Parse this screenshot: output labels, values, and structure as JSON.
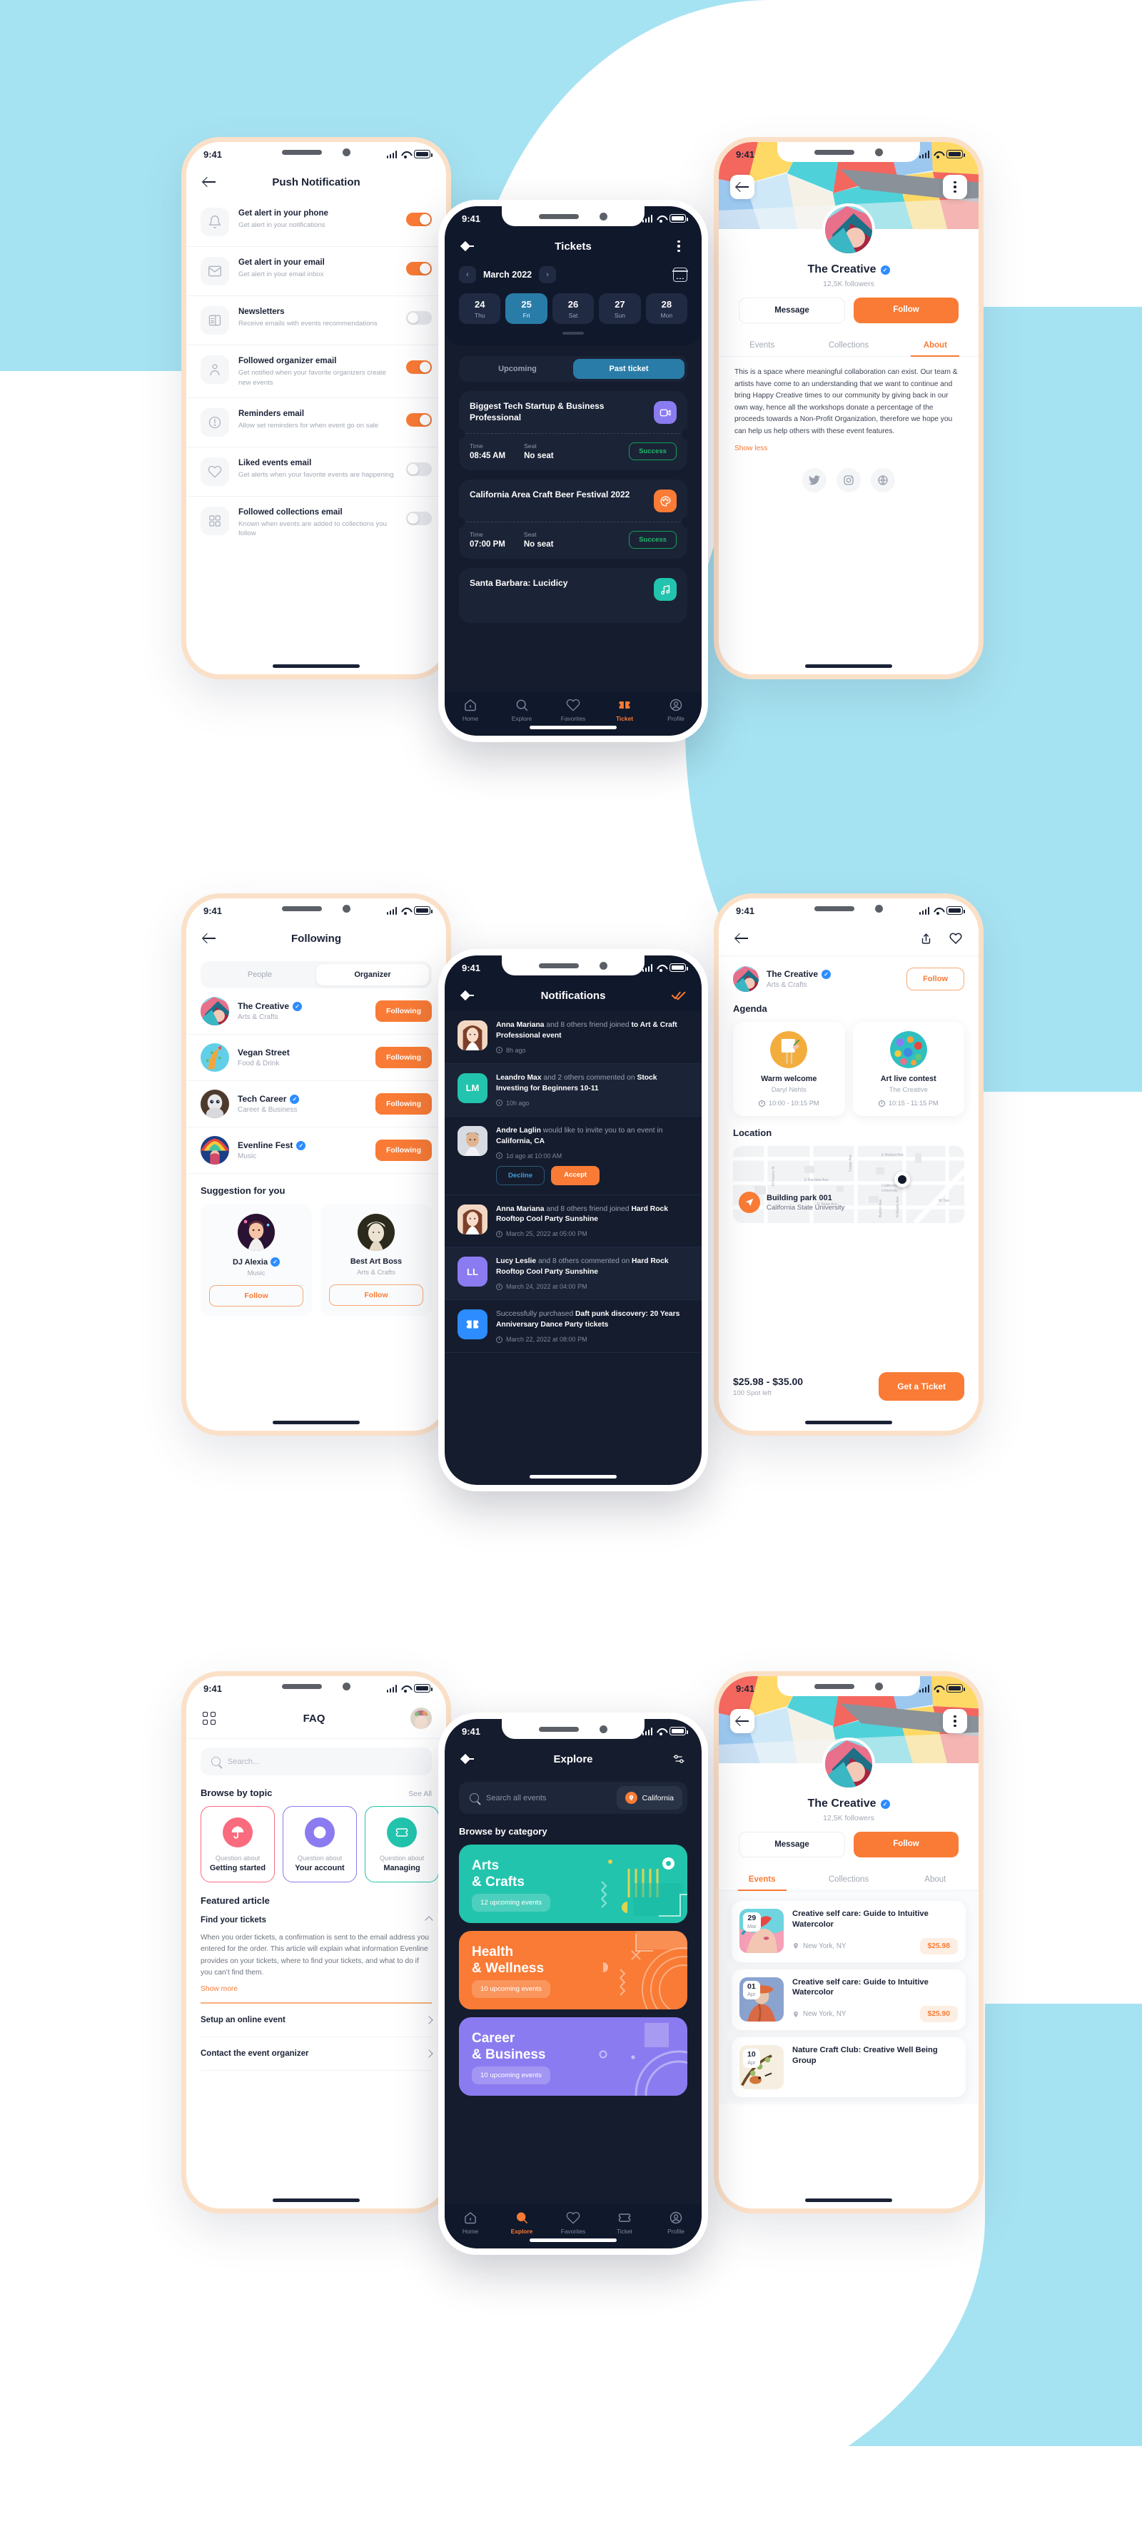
{
  "colors": {
    "accent": "#f97b35",
    "dark_bg": "#151c2e",
    "dark_card": "#1b2336",
    "blue": "#2a7ca8",
    "teal": "#22c4ad",
    "purple": "#8b7bf0",
    "bg": "#a6e3f2"
  },
  "status_bar": {
    "time": "9:41"
  },
  "screens": {
    "push_notification": {
      "title": "Push Notification",
      "items": [
        {
          "icon": "bell-icon",
          "title": "Get alert in your phone",
          "sub": "Get alert in your notifications",
          "on": true
        },
        {
          "icon": "mail-icon",
          "title": "Get alert in your email",
          "sub": "Get alert in your email inbox",
          "on": true
        },
        {
          "icon": "newspaper-icon",
          "title": "Newsletters",
          "sub": "Receive emails with events recommendations",
          "on": false
        },
        {
          "icon": "user-icon",
          "title": "Followed organizer email",
          "sub": "Get notified when your favorite organizers create new events",
          "on": true
        },
        {
          "icon": "alert-icon",
          "title": "Reminders email",
          "sub": "Allow set reminders for when event go on sale",
          "on": true
        },
        {
          "icon": "heart-icon",
          "title": "Liked events email",
          "sub": "Get alerts when your favorite events are happening",
          "on": false
        },
        {
          "icon": "grid-icon",
          "title": "Followed collections email",
          "sub": "Known when events are added to collections you follow",
          "on": false
        }
      ]
    },
    "tickets": {
      "title": "Tickets",
      "month": "March 2022",
      "days": [
        {
          "d": "24",
          "w": "Thu",
          "sel": false
        },
        {
          "d": "25",
          "w": "Fri",
          "sel": true
        },
        {
          "d": "26",
          "w": "Sat",
          "sel": false
        },
        {
          "d": "27",
          "w": "Sun",
          "sel": false
        },
        {
          "d": "28",
          "w": "Mon",
          "sel": false
        }
      ],
      "segments": [
        {
          "label": "Upcoming",
          "sel": false
        },
        {
          "label": "Past ticket",
          "sel": true
        }
      ],
      "time_label": "Time",
      "seat_label": "Seat",
      "cards": [
        {
          "name": "Biggest Tech Startup & Business Professional",
          "time": "08:45 AM",
          "seat": "No seat",
          "status": "Success",
          "badge": "video-icon",
          "badge_color": "#8b7bf0"
        },
        {
          "name": "California Area Craft Beer Festival 2022",
          "time": "07:00 PM",
          "seat": "No seat",
          "status": "Success",
          "badge": "palette-icon",
          "badge_color": "#f97b35"
        },
        {
          "name": "Santa Barbara: Lucidicy",
          "time": "",
          "seat": "",
          "status": "",
          "badge": "music-icon",
          "badge_color": "#22c4ad"
        }
      ],
      "tabbar": [
        {
          "label": "Home",
          "icon": "home-icon",
          "sel": false
        },
        {
          "label": "Explore",
          "icon": "search-icon",
          "sel": false
        },
        {
          "label": "Favorites",
          "icon": "heart-icon",
          "sel": false
        },
        {
          "label": "Ticket",
          "icon": "ticket-icon",
          "sel": true
        },
        {
          "label": "Profile",
          "icon": "profile-icon",
          "sel": false
        }
      ]
    },
    "creative_about": {
      "name": "The Creative",
      "followers": "12,5K followers",
      "message_label": "Message",
      "follow_label": "Follow",
      "tabs": [
        {
          "label": "Events",
          "sel": false
        },
        {
          "label": "Collections",
          "sel": false
        },
        {
          "label": "About",
          "sel": true
        }
      ],
      "about_text": "This is a space where meaningful collaboration can exist. Our team & artists have come to an understanding that we want to continue and bring Happy Creative times to our community by giving back in our own way, hence all the workshops donate a percentage of the proceeds towards a Non-Profit Organization, therefore we hope you can help us help others with these event features.",
      "show_less": "Show less",
      "socials": [
        "twitter-icon",
        "instagram-icon",
        "globe-icon"
      ]
    },
    "following": {
      "title": "Following",
      "segments": [
        {
          "label": "People",
          "sel": false
        },
        {
          "label": "Organizer",
          "sel": true
        }
      ],
      "rows": [
        {
          "name": "The Creative",
          "cat": "Arts & Crafts",
          "verified": true,
          "btn": "Following"
        },
        {
          "name": "Vegan Street",
          "cat": "Food & Drink",
          "verified": false,
          "btn": "Following"
        },
        {
          "name": "Tech Career",
          "cat": "Career & Business",
          "verified": true,
          "btn": "Following"
        },
        {
          "name": "Evenline Fest",
          "cat": "Music",
          "verified": true,
          "btn": "Following"
        }
      ],
      "suggestion_title": "Suggestion for you",
      "suggestions": [
        {
          "name": "DJ Alexia",
          "cat": "Music",
          "verified": true,
          "btn": "Follow"
        },
        {
          "name": "Best Art Boss",
          "cat": "Arts & Crafts",
          "verified": false,
          "btn": "Follow"
        }
      ]
    },
    "notifications": {
      "title": "Notifications",
      "mark_read_icon": "double-check-icon",
      "items": [
        {
          "avatar": "photo",
          "avatar_color": "#f0cbb0",
          "initials": "",
          "lead": "Anna Mariana",
          "mid": " and 8 others friend joined ",
          "tail": "to Art & Craft Professional event",
          "time": "8h ago",
          "highlight": false,
          "actions": false
        },
        {
          "avatar": "initials",
          "avatar_color": "#22c4ad",
          "initials": "LM",
          "lead": "Leandro Max",
          "mid": " and 2 others commented on ",
          "tail": "Stock Investing for Beginners 10-11",
          "time": "10h ago",
          "highlight": true,
          "actions": false
        },
        {
          "avatar": "photo",
          "avatar_color": "#cfd5df",
          "initials": "",
          "lead": "Andre Laglin",
          "mid": " would like to invite you to an event in ",
          "tail": "California, CA",
          "time": "1d ago at 10:00 AM",
          "highlight": false,
          "actions": true,
          "decline": "Decline",
          "accept": "Accept"
        },
        {
          "avatar": "photo",
          "avatar_color": "#f0cbb0",
          "initials": "",
          "lead": "Anna Mariana",
          "mid": " and 8 others friend joined ",
          "tail": "Hard Rock Rooftop Cool Party Sunshine",
          "time": "March 25, 2022 at 05:00 PM",
          "highlight": false,
          "actions": false
        },
        {
          "avatar": "initials",
          "avatar_color": "#8b7bf0",
          "initials": "LL",
          "lead": "Lucy Leslie",
          "mid": " and 8 others commented on ",
          "tail": "Hard Rock Rooftop Cool Party Sunshine",
          "time": "March 24, 2022 at 04:00 PM",
          "highlight": true,
          "actions": false
        },
        {
          "avatar": "ticket",
          "avatar_color": "#2d8cff",
          "initials": "",
          "lead": "",
          "mid": "Successfully purchased ",
          "tail": "Daft punk discovery: 20 Years Anniversary Dance Party tickets",
          "time": "March 22, 2022 at 08:00 PM",
          "highlight": false,
          "actions": false
        }
      ]
    },
    "event_detail": {
      "organizer": {
        "name": "The Creative",
        "cat": "Arts & Crafts",
        "verified": true,
        "follow": "Follow"
      },
      "agenda_title": "Agenda",
      "agenda": [
        {
          "title": "Warm welcome",
          "sub": "Daryl Nehls",
          "time": "10:00 - 10:15 PM"
        },
        {
          "title": "Art live contest",
          "sub": "The Creative",
          "time": "10:15 - 11:15 PM"
        }
      ],
      "location_title": "Location",
      "location": {
        "name": "Building park 001",
        "address": "California State University",
        "map_labels": [
          "E Bullard Ave",
          "Cedar Ave",
          "N Fresno St",
          "E Barstow Ave",
          "E Shaw Ave",
          "N Maple Ave",
          "Barton Ave",
          "California State University",
          "W San"
        ]
      },
      "price": "$25.98 - $35.00",
      "spots": "100 Spot left",
      "cta": "Get a Ticket"
    },
    "faq": {
      "title": "FAQ",
      "search_placeholder": "Search...",
      "browse_title": "Browse by topic",
      "see_all": "See All",
      "topics": [
        {
          "q": "Question about",
          "n": "Getting started",
          "color": "#fa6b7e",
          "icon": "umbrella-icon"
        },
        {
          "q": "Question about",
          "n": "Your account",
          "color": "#8b7bf0",
          "icon": "account-icon"
        },
        {
          "q": "Question about",
          "n": "Managing",
          "color": "#22c4ad",
          "icon": "ticket-icon"
        }
      ],
      "featured_title": "Featured article",
      "featured_q": "Find your tickets",
      "featured_body": "When you order tickets, a confirmation is sent to the email address you entered for the order. This article will explain what information Evenline provides on your tickets, where to find your tickets, and what to do if you can’t find them.",
      "show_more": "Show more",
      "items": [
        "Setup an online event",
        "Contact the event organizer"
      ]
    },
    "explore": {
      "title": "Explore",
      "filter_icon": "sliders-icon",
      "search_placeholder": "Search all events",
      "location_chip": "California",
      "browse_title": "Browse by category",
      "categories": [
        {
          "name": "Arts\n& Crafts",
          "line1": "Arts",
          "line2": "& Crafts",
          "count": "12 upcoming events",
          "color": "#22c4ad"
        },
        {
          "name": "Health\n& Wellness",
          "line1": "Health",
          "line2": "& Wellness",
          "count": "10 upcoming events",
          "color": "#f97b35"
        },
        {
          "name": "Career\n& Business",
          "line1": "Career",
          "line2": "& Business",
          "count": "10 upcoming events",
          "color": "#8b7bf0"
        }
      ],
      "tabbar": [
        {
          "label": "Home",
          "icon": "home-icon",
          "sel": false
        },
        {
          "label": "Explore",
          "icon": "search-icon",
          "sel": true
        },
        {
          "label": "Favorites",
          "icon": "heart-icon",
          "sel": false
        },
        {
          "label": "Ticket",
          "icon": "ticket-icon",
          "sel": false
        },
        {
          "label": "Profile",
          "icon": "profile-icon",
          "sel": false
        }
      ]
    },
    "creative_events": {
      "name": "The Creative",
      "followers": "12,5K followers",
      "message_label": "Message",
      "follow_label": "Follow",
      "tabs": [
        {
          "label": "Events",
          "sel": true
        },
        {
          "label": "Collections",
          "sel": false
        },
        {
          "label": "About",
          "sel": false
        }
      ],
      "events": [
        {
          "day": "29",
          "mon": "Mar",
          "title": "Creative self care: Guide to Intuitive Watercolor",
          "loc": "New York, NY",
          "price": "$25.98"
        },
        {
          "day": "01",
          "mon": "Apr",
          "title": "Creative self care: Guide to Intuitive Watercolor",
          "loc": "New York, NY",
          "price": "$25.90"
        },
        {
          "day": "10",
          "mon": "Apr",
          "title": "Nature Craft Club: Creative Well Being Group",
          "loc": "",
          "price": ""
        }
      ]
    }
  }
}
